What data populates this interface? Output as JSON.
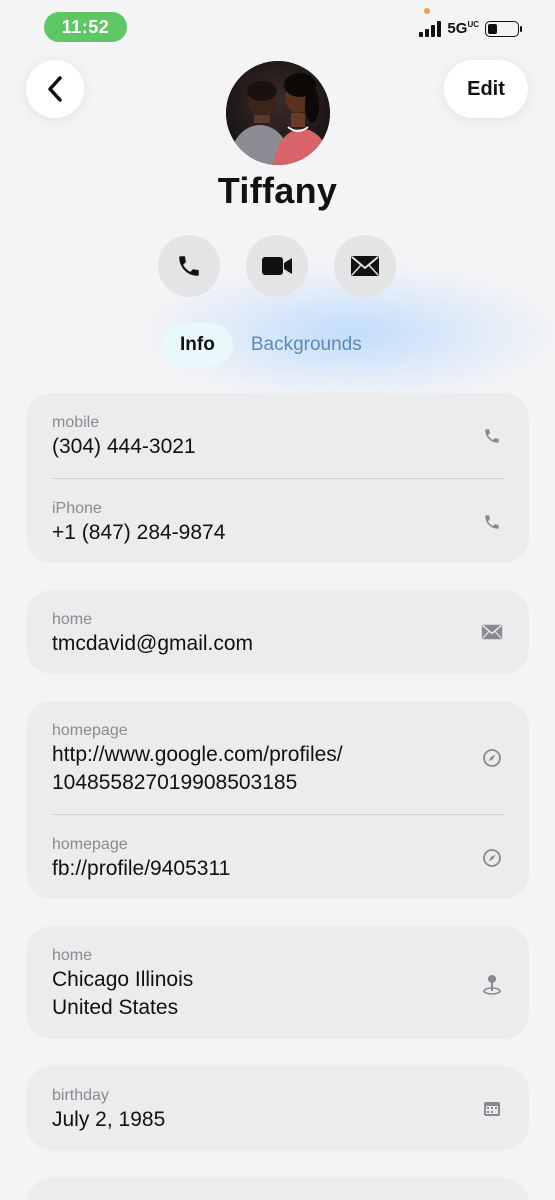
{
  "status_bar": {
    "time": "11:52",
    "network": "5G",
    "network_sub": "UC"
  },
  "header": {
    "edit_label": "Edit"
  },
  "contact": {
    "name": "Tiffany"
  },
  "tabs": {
    "info": "Info",
    "backgrounds": "Backgrounds"
  },
  "phones": [
    {
      "label": "mobile",
      "value": "(304) 444-3021",
      "icon": "phone-icon"
    },
    {
      "label": "iPhone",
      "value": "+1 (847) 284-9874",
      "icon": "phone-icon"
    }
  ],
  "email": {
    "label": "home",
    "value": "tmcdavid@gmail.com",
    "icon": "mail-icon"
  },
  "homepages": [
    {
      "label": "homepage",
      "value_line1": "http://www.google.com/profiles/",
      "value_line2": "104855827019908503185",
      "icon": "compass-icon"
    },
    {
      "label": "homepage",
      "value": "fb://profile/9405311",
      "icon": "compass-icon"
    }
  ],
  "address": {
    "label": "home",
    "line1": "Chicago Illinois",
    "line2": "United States",
    "icon": "map-pin-icon"
  },
  "birthday": {
    "label": "birthday",
    "value": "July 2, 1985",
    "icon": "calendar-icon"
  },
  "colors": {
    "accent_blue": "#5d8ab6",
    "time_pill": "#5ec663",
    "card_bg": "#ececef",
    "label_gray": "#8a8a8e"
  }
}
